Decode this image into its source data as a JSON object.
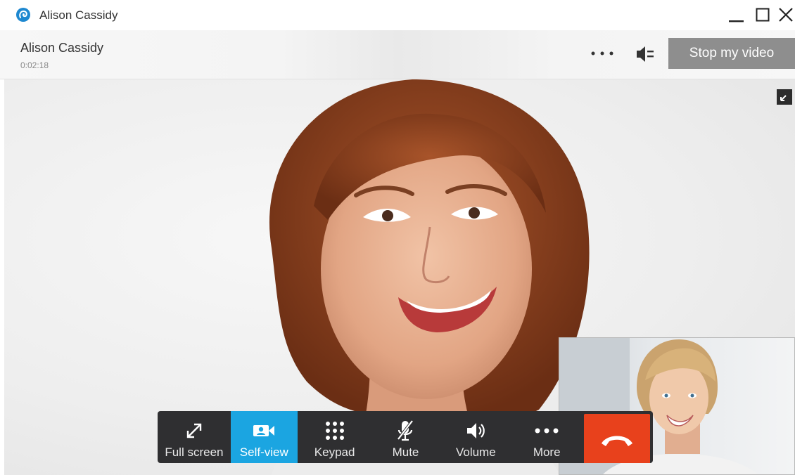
{
  "window": {
    "title": "Alison Cassidy",
    "controls": {
      "minimize": "minimize-icon",
      "maximize": "maximize-icon",
      "close": "close-icon"
    }
  },
  "call": {
    "contact_name": "Alison Cassidy",
    "duration": "0:02:18",
    "stop_video_label": "Stop my video"
  },
  "toolbar": {
    "fullscreen_label": "Full screen",
    "selfview_label": "Self-view",
    "keypad_label": "Keypad",
    "mute_label": "Mute",
    "volume_label": "Volume",
    "more_label": "More"
  },
  "colors": {
    "accent_blue": "#1ba5e1",
    "end_call_red": "#e8411c",
    "toolbar_bg": "#2f2f31",
    "stop_video_bg": "#8e8e8e"
  }
}
